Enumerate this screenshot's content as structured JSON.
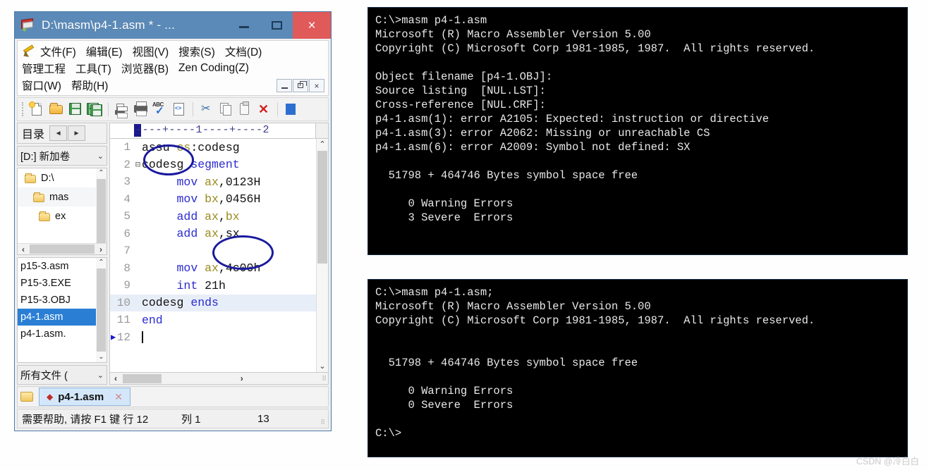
{
  "editor_window": {
    "title": "D:\\masm\\p4-1.asm * - ...",
    "app_icon": "masm-editor-icon",
    "titlebar_buttons": {
      "minimize": "minimize-icon",
      "maximize": "maximize-icon",
      "close": "×"
    },
    "menu": {
      "row1": [
        "文件(F)",
        "编辑(E)",
        "视图(V)",
        "搜索(S)",
        "文档(D)"
      ],
      "row2": [
        "管理工程",
        "工具(T)",
        "浏览器(B)",
        "Zen Coding(Z)"
      ],
      "row3": [
        "窗口(W)",
        "帮助(H)"
      ]
    },
    "mdi_buttons": {
      "minimize": "minimize-icon",
      "restore": "restore-icon",
      "close": "×"
    },
    "toolbar_icons": [
      "new-file-icon",
      "open-folder-icon",
      "save-icon",
      "save-all-icon",
      "page-setup-icon",
      "print-icon",
      "spellcheck-icon",
      "html-tag-icon",
      "cut-icon",
      "copy-icon",
      "paste-icon",
      "delete-icon",
      "blue-bar-icon"
    ],
    "left_panel": {
      "header_label": "目录",
      "nav_prev": "◄",
      "nav_next": "►",
      "drive_label": "[D:] 新加卷",
      "tree": [
        {
          "label": "D:\\",
          "depth": 0,
          "selected": false
        },
        {
          "label": "mas",
          "depth": 1,
          "selected": true
        },
        {
          "label": "ex",
          "depth": 2,
          "selected": false
        }
      ],
      "files": [
        {
          "name": "p15-3.asm",
          "selected": false
        },
        {
          "name": "P15-3.EXE",
          "selected": false
        },
        {
          "name": "P15-3.OBJ",
          "selected": false
        },
        {
          "name": "p4-1.asm",
          "selected": true
        },
        {
          "name": "p4-1.asm.",
          "selected": false
        }
      ],
      "filter_label": "所有文件 ("
    },
    "ruler": "----+----1----+----2",
    "code_lines": [
      {
        "num": "1",
        "fold": "",
        "tokens": [
          {
            "t": "assu ",
            "c": "plain"
          },
          {
            "t": "cs",
            "c": "reg"
          },
          {
            "t": ":codesg",
            "c": "plain"
          }
        ],
        "highlight": false
      },
      {
        "num": "2",
        "fold": "⊟",
        "tokens": [
          {
            "t": "codesg ",
            "c": "plain"
          },
          {
            "t": "segment",
            "c": "kw"
          }
        ],
        "highlight": false
      },
      {
        "num": "3",
        "fold": "",
        "tokens": [
          {
            "t": "     ",
            "c": "plain"
          },
          {
            "t": "mov",
            "c": "kw"
          },
          {
            "t": " ",
            "c": "plain"
          },
          {
            "t": "ax",
            "c": "reg"
          },
          {
            "t": ",0123H",
            "c": "plain"
          }
        ],
        "highlight": false
      },
      {
        "num": "4",
        "fold": "",
        "tokens": [
          {
            "t": "     ",
            "c": "plain"
          },
          {
            "t": "mov",
            "c": "kw"
          },
          {
            "t": " ",
            "c": "plain"
          },
          {
            "t": "bx",
            "c": "reg"
          },
          {
            "t": ",0456H",
            "c": "plain"
          }
        ],
        "highlight": false
      },
      {
        "num": "5",
        "fold": "",
        "tokens": [
          {
            "t": "     ",
            "c": "plain"
          },
          {
            "t": "add",
            "c": "kw"
          },
          {
            "t": " ",
            "c": "plain"
          },
          {
            "t": "ax",
            "c": "reg"
          },
          {
            "t": ",",
            "c": "plain"
          },
          {
            "t": "bx",
            "c": "reg"
          }
        ],
        "highlight": false
      },
      {
        "num": "6",
        "fold": "",
        "tokens": [
          {
            "t": "     ",
            "c": "plain"
          },
          {
            "t": "add",
            "c": "kw"
          },
          {
            "t": " ",
            "c": "plain"
          },
          {
            "t": "ax",
            "c": "reg"
          },
          {
            "t": ",sx",
            "c": "plain"
          }
        ],
        "highlight": false
      },
      {
        "num": "7",
        "fold": "",
        "tokens": [
          {
            "t": "",
            "c": "plain"
          }
        ],
        "highlight": false
      },
      {
        "num": "8",
        "fold": "",
        "tokens": [
          {
            "t": "     ",
            "c": "plain"
          },
          {
            "t": "mov",
            "c": "kw"
          },
          {
            "t": " ",
            "c": "plain"
          },
          {
            "t": "ax",
            "c": "reg"
          },
          {
            "t": ",4c00h",
            "c": "plain"
          }
        ],
        "highlight": false
      },
      {
        "num": "9",
        "fold": "",
        "tokens": [
          {
            "t": "     ",
            "c": "plain"
          },
          {
            "t": "int",
            "c": "kw"
          },
          {
            "t": " 21h",
            "c": "plain"
          }
        ],
        "highlight": false
      },
      {
        "num": "10",
        "fold": "",
        "tokens": [
          {
            "t": "codesg ",
            "c": "plain"
          },
          {
            "t": "ends",
            "c": "kw"
          }
        ],
        "highlight": true
      },
      {
        "num": "11",
        "fold": "",
        "tokens": [
          {
            "t": "end",
            "c": "kw"
          }
        ],
        "highlight": false
      },
      {
        "num": "12",
        "fold": "",
        "tokens": [
          {
            "t": "",
            "c": "plain"
          }
        ],
        "highlight": false,
        "caret": true,
        "marker": true
      }
    ],
    "tab": {
      "filename": "p4-1.asm",
      "modified_dot": "◆",
      "close": "✕"
    },
    "statusbar": {
      "help": "需要帮助, 请按 F1 键  行 12",
      "column": "列 1",
      "count": "13"
    }
  },
  "console_top": {
    "lines": [
      "C:\\>masm p4-1.asm",
      "Microsoft (R) Macro Assembler Version 5.00",
      "Copyright (C) Microsoft Corp 1981-1985, 1987.  All rights reserved.",
      "",
      "Object filename [p4-1.OBJ]:",
      "Source listing  [NUL.LST]:",
      "Cross-reference [NUL.CRF]:",
      "p4-1.asm(1): error A2105: Expected: instruction or directive",
      "p4-1.asm(3): error A2062: Missing or unreachable CS",
      "p4-1.asm(6): error A2009: Symbol not defined: SX",
      "",
      "  51798 + 464746 Bytes symbol space free",
      "",
      "     0 Warning Errors",
      "     3 Severe  Errors"
    ]
  },
  "console_bottom": {
    "lines": [
      "C:\\>masm p4-1.asm;",
      "Microsoft (R) Macro Assembler Version 5.00",
      "Copyright (C) Microsoft Corp 1981-1985, 1987.  All rights reserved.",
      "",
      "",
      "  51798 + 464746 Bytes symbol space free",
      "",
      "     0 Warning Errors",
      "     0 Severe  Errors",
      "",
      "C:\\>"
    ]
  },
  "watermark": "CSDN @冷白白",
  "annotations": [
    {
      "name": "ellipse-assume",
      "target": "assu cs"
    },
    {
      "name": "ellipse-sx",
      "target": "ax,sx"
    }
  ],
  "colors": {
    "titlebar": "#5b8ab8",
    "close_button": "#e05a5a",
    "selection": "#2a7fd4",
    "keyword": "#2b2bd0",
    "register": "#9a8b20",
    "annotation": "#1a1a9e",
    "console_bg": "#000000"
  }
}
